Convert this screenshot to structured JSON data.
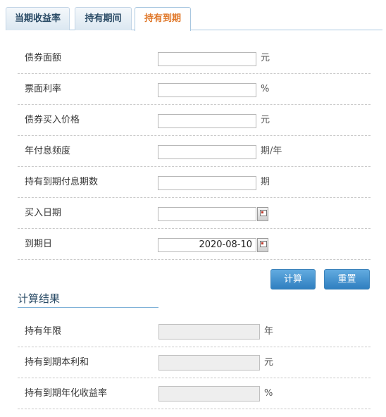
{
  "tabs": [
    {
      "label": "当期收益率",
      "active": false
    },
    {
      "label": "持有期间",
      "active": false
    },
    {
      "label": "持有到期",
      "active": true
    }
  ],
  "form": {
    "face_value": {
      "label": "债券面额",
      "value": "",
      "unit": "元"
    },
    "coupon_rate": {
      "label": "票面利率",
      "value": "",
      "unit": "%"
    },
    "purchase_price": {
      "label": "债券买入价格",
      "value": "",
      "unit": "元"
    },
    "payment_frequency": {
      "label": "年付息频度",
      "value": "",
      "unit": "期/年"
    },
    "periods_to_maturity": {
      "label": "持有到期付息期数",
      "value": "",
      "unit": "期"
    },
    "purchase_date": {
      "label": "买入日期",
      "value": ""
    },
    "maturity_date": {
      "label": "到期日",
      "value": "2020-08-10"
    }
  },
  "buttons": {
    "calculate": "计算",
    "reset": "重置"
  },
  "results": {
    "title": "计算结果",
    "holding_years": {
      "label": "持有年限",
      "value": "",
      "unit": "年"
    },
    "principal_interest": {
      "label": "持有到期本利和",
      "value": "",
      "unit": "元"
    },
    "annualized_yield": {
      "label": "持有到期年化收益率",
      "value": "",
      "unit": "%"
    }
  },
  "colors": {
    "accent": "#e0782a",
    "button": "#2f7fc0",
    "tab_text": "#2a4b66"
  }
}
